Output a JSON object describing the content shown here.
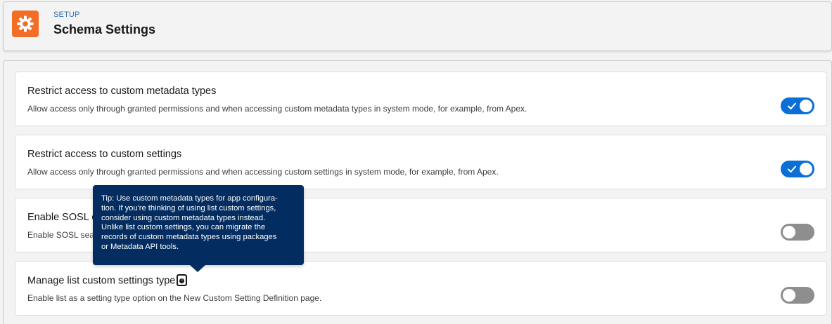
{
  "header": {
    "eyebrow": "SETUP",
    "title": "Schema Settings",
    "icon": "gear-icon",
    "icon_color": "#f26d26"
  },
  "settings": [
    {
      "title": "Restrict access to custom metadata types",
      "description": "Allow access only through granted permissions and when accessing custom metadata types in system mode, for example, from Apex.",
      "enabled": true
    },
    {
      "title": "Restrict access to custom settings",
      "description": "Allow access only through granted permissions and when accessing custom settings in system mode, for example, from Apex.",
      "enabled": true
    },
    {
      "title": "Enable SOSL o",
      "description": "Enable SOSL sea",
      "enabled": false
    },
    {
      "title": "Manage list custom settings type",
      "description": "Enable list as a setting type option on the New Custom Setting Definition page.",
      "enabled": false,
      "has_info_icon": true
    }
  ],
  "tooltip": {
    "lines": [
      "Tip: Use custom metadata types for app configura-",
      "tion. If you're thinking of using list custom settings,",
      "consider using custom metadata types instead.",
      "Unlike list custom settings, you can migrate the",
      "records of custom metadata types using packages",
      "or Metadata API tools."
    ]
  },
  "colors": {
    "toggle_on": "#0b6fd6",
    "toggle_off": "#8e8e8e",
    "tooltip_bg": "#032d60",
    "eyebrow": "#2e6fb5"
  }
}
